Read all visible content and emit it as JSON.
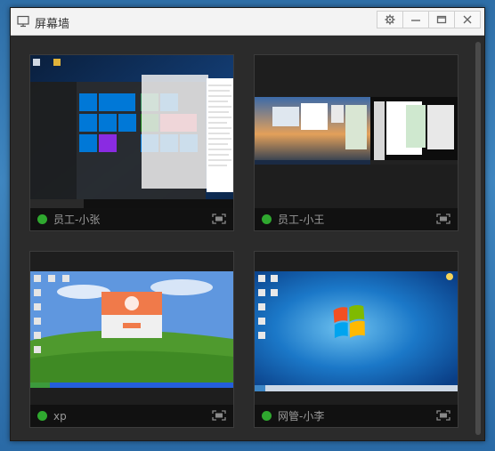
{
  "window": {
    "title": "屏幕墙",
    "controls": {
      "settings_icon": "gear-icon",
      "minimize_icon": "minimize-icon",
      "maximize_icon": "maximize-icon",
      "close_icon": "close-icon"
    }
  },
  "tiles": [
    {
      "label": "员工-小张",
      "status": "online",
      "os": "Windows 10",
      "status_color": "#2fa82f"
    },
    {
      "label": "员工-小王",
      "status": "online",
      "os": "Windows 7 multi-monitor",
      "status_color": "#2fa82f"
    },
    {
      "label": "xp",
      "status": "online",
      "os": "Windows XP",
      "status_color": "#2fa82f"
    },
    {
      "label": "网管-小李",
      "status": "online",
      "os": "Windows 7",
      "status_color": "#2fa82f"
    }
  ],
  "colors": {
    "window_bg": "#2b2b2b",
    "titlebar_bg": "#f3f3f3",
    "online": "#2fa82f",
    "label_text": "#9a9a9a"
  }
}
